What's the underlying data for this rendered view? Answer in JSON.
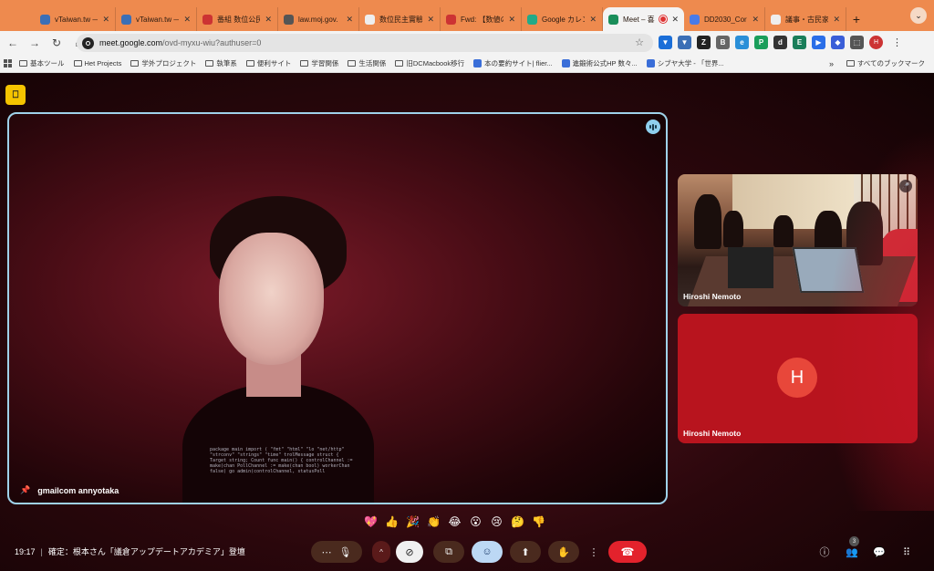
{
  "browser": {
    "tabs": [
      {
        "title": "vTaiwan.tw — l",
        "color": "#3b6fb6"
      },
      {
        "title": "vTaiwan.tw —",
        "color": "#3b6fb6"
      },
      {
        "title": "番組 数位公民悪",
        "color": "#c33"
      },
      {
        "title": "law.moj.gov.",
        "color": "#555"
      },
      {
        "title": "数位民主實驗午",
        "color": "#eee"
      },
      {
        "title": "Fwd: 【数値の",
        "color": "#c33"
      },
      {
        "title": "Google カレン",
        "color": "#2a8"
      },
      {
        "title": "Meet – 喜",
        "color": "#1a8e5a",
        "active": true
      },
      {
        "title": "DD2030_Cor",
        "color": "#4a7be8"
      },
      {
        "title": "議事・古民家の",
        "color": "#eee"
      }
    ],
    "url_domain": "meet.google.com",
    "url_path": "/ovd-myxu-wiu?authuser=0",
    "extensions": [
      {
        "label": "▼",
        "color": "#1a6ed8"
      },
      {
        "label": "▼",
        "color": "#3b6fb6"
      },
      {
        "label": "Z",
        "color": "#222"
      },
      {
        "label": "B",
        "color": "#666"
      },
      {
        "label": "e",
        "color": "#2a8fd8"
      },
      {
        "label": "P",
        "color": "#1a9e5a"
      },
      {
        "label": "d",
        "color": "#333"
      },
      {
        "label": "E",
        "color": "#1a7e5a"
      },
      {
        "label": "▶",
        "color": "#2a6ee8"
      },
      {
        "label": "◆",
        "color": "#3a5ed8"
      },
      {
        "label": "⬚",
        "color": "#555"
      }
    ],
    "profile_initial": "H",
    "bookmarks": [
      {
        "label": "基本ツール",
        "type": "folder"
      },
      {
        "label": "Het Projects",
        "type": "folder"
      },
      {
        "label": "学外プロジェクト",
        "type": "folder"
      },
      {
        "label": "執筆系",
        "type": "folder"
      },
      {
        "label": "便利サイト",
        "type": "folder"
      },
      {
        "label": "学習関係",
        "type": "folder"
      },
      {
        "label": "生活関係",
        "type": "folder"
      },
      {
        "label": "旧DCMacbook移行",
        "type": "folder"
      },
      {
        "label": "本の要約サイト| flier...",
        "type": "site"
      },
      {
        "label": "進鍛術公式HP 数々...",
        "type": "site"
      },
      {
        "label": "シブヤ大学 - 「世界...",
        "type": "site"
      }
    ],
    "bookmarks_more": "»",
    "all_bookmarks": "すべてのブックマーク"
  },
  "meet": {
    "main_tile": {
      "name": "gmailcom annyotaka",
      "tee_code": "package main import ( \"fmt\" \"html\" \"lo \"net/http\" \"strconv\" \"strings\" \"time\" trolMessage struct { Target string; Count func main() { controlChannel := make(chan PollChannel := make(chan bool) workerChan false) go admin(controlChannel, statusPoll"
    },
    "participants": [
      {
        "name": "Hiroshi Nemoto",
        "kind": "video"
      },
      {
        "name": "Hiroshi Nemoto",
        "kind": "avatar",
        "initial": "H"
      }
    ],
    "reactions": [
      "💖",
      "👍",
      "🎉",
      "👏",
      "😂",
      "😮",
      "😢",
      "🤔",
      "👎"
    ],
    "time": "19:17",
    "meeting_title": "確定：根本さん「議倉アップデートアカデミア」登壇",
    "people_count": "3"
  }
}
